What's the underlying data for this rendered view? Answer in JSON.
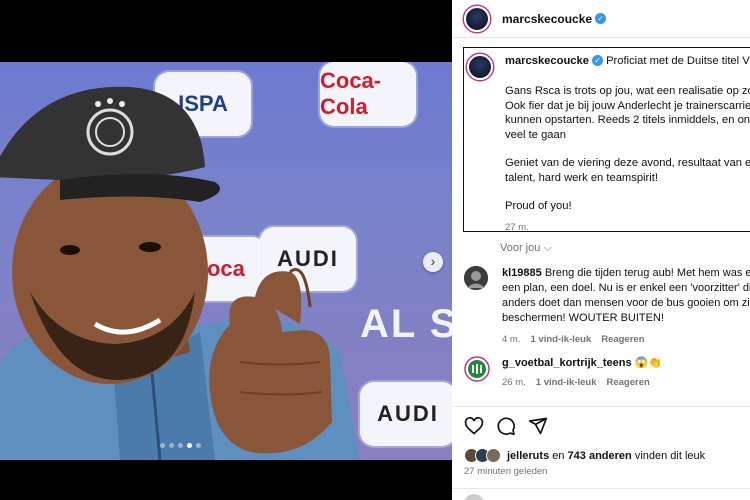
{
  "media": {
    "sponsors": [
      "ISPA",
      "Coca-Cola",
      "Coca",
      "AUDI",
      "AUDI",
      "AL S"
    ],
    "carousel_next_icon": "chevron-right-icon",
    "carousel_dots": 5,
    "carousel_active": 3
  },
  "header": {
    "username": "marcskecoucke",
    "verified_icon": "verified-badge-icon"
  },
  "caption": {
    "username": "marcskecoucke",
    "first_line": "Proficiat met de Duitse titel Vince",
    "paragraphs": [
      "Gans Rsca is trots op jou, wat een realisatie op zo ko\nOok fier dat je bij jouw Anderlecht je trainerscarriere\nkunnen opstarten. Reeds 2 titels inmiddels, en onget\nveel te gaan",
      "Geniet van de viering deze avond, resultaat van een\ntalent, hard werk en teamspirit!",
      "Proud of you!"
    ],
    "time": "27 m."
  },
  "for_you": "Voor jou",
  "comments": [
    {
      "username": "kl19885",
      "text": "Breng die tijden terug aub! Met hem was er een plan, een doel. Nu is er enkel een 'voorzitter' die anders doet dan mensen voor de bus gooien om zich beschermen! WOUTER BUITEN!",
      "time": "4 m.",
      "likes": "1 vind-ik-leuk",
      "reply": "Reageren"
    },
    {
      "username": "g_voetbal_kortrijk_teens",
      "text": "😱👏",
      "time": "26 m.",
      "likes": "1 vind-ik-leuk",
      "reply": "Reageren"
    }
  ],
  "actions": {
    "like_icon": "heart-icon",
    "comment_icon": "comment-icon",
    "share_icon": "share-icon"
  },
  "likes": {
    "user": "jelleruts",
    "connector": "en",
    "count_text": "743 anderen",
    "suffix": "vinden dit leuk"
  },
  "timestamp": "27 minuten geleden",
  "colors": {
    "verified": "#3797f0",
    "photo_bg": "#7a82c9",
    "meta_grey": "#737373"
  }
}
